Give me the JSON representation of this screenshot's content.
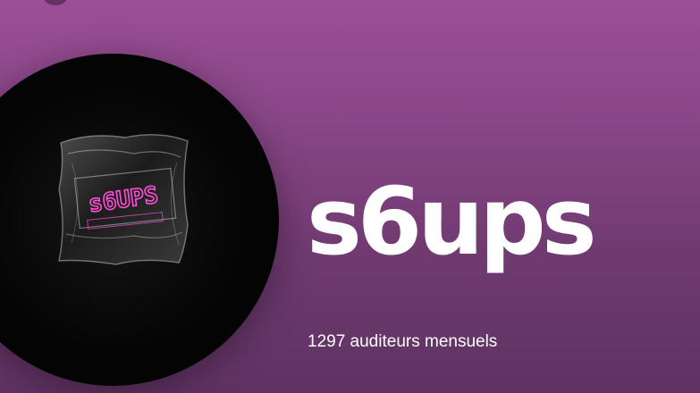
{
  "artist": {
    "name": "s6ups",
    "monthly_listeners": "1297 auditeurs mensuels",
    "artwork_text": "s6UPS"
  },
  "theme": {
    "background_top": "#9b4f97",
    "background_bottom": "#5f3262",
    "artwork_text_color": "#ff4fd8"
  },
  "icons": {
    "back": "chevron-left-icon"
  }
}
